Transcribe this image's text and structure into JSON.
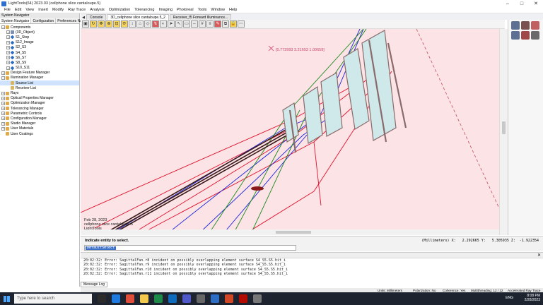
{
  "window": {
    "title": "LightTools(64) 2023.03  (cellphone slice cantaloupe.5)",
    "controls": [
      "–",
      "□",
      "✕"
    ]
  },
  "menu": [
    "File",
    "Edit",
    "View",
    "Insert",
    "Modify",
    "Ray Trace",
    "Analysis",
    "Optimization",
    "Tolerancing",
    "Imaging",
    "Photoreal",
    "Tools",
    "Window",
    "Help"
  ],
  "navigator": {
    "panel_title": "System Navigator",
    "tabs": [
      "System Navigator",
      "Configuration",
      "Preferences Na..."
    ],
    "tree": [
      {
        "label": "Components",
        "level": 0,
        "icon": "folder-icon",
        "expander": "−"
      },
      {
        "label": "(3D_Object)",
        "level": 1,
        "icon": "object-icon",
        "expander": "+"
      },
      {
        "label": "S1_Stop",
        "level": 1,
        "icon": "surface-icon",
        "expander": "+"
      },
      {
        "label": "S12_Image",
        "level": 1,
        "icon": "surface-icon",
        "expander": "+"
      },
      {
        "label": "S2_S3",
        "level": 1,
        "icon": "surface-icon",
        "expander": "+"
      },
      {
        "label": "S4_S5",
        "level": 1,
        "icon": "surface-icon",
        "expander": "+"
      },
      {
        "label": "S6_S7",
        "level": 1,
        "icon": "surface-icon",
        "expander": "+"
      },
      {
        "label": "S8_S9",
        "level": 1,
        "icon": "surface-icon",
        "expander": "+"
      },
      {
        "label": "S10_S11",
        "level": 1,
        "icon": "surface-icon",
        "expander": "+"
      },
      {
        "label": "Design Feature Manager",
        "level": 0,
        "icon": "folder-icon",
        "expander": "+"
      },
      {
        "label": "Illumination Manager",
        "level": 0,
        "icon": "folder-icon",
        "expander": "−"
      },
      {
        "label": "Source List",
        "level": 1,
        "icon": "list-icon",
        "expander": "",
        "selected": true
      },
      {
        "label": "Receiver List",
        "level": 1,
        "icon": "list-icon",
        "expander": ""
      },
      {
        "label": "Rays",
        "level": 0,
        "icon": "folder-icon",
        "expander": "+"
      },
      {
        "label": "Optical Properties Manager",
        "level": 0,
        "icon": "folder-icon",
        "expander": "+"
      },
      {
        "label": "Optimization Manager",
        "level": 0,
        "icon": "folder-icon",
        "expander": "+"
      },
      {
        "label": "Tolerancing Manager",
        "level": 0,
        "icon": "folder-icon",
        "expander": "+"
      },
      {
        "label": "Parametric Controls",
        "level": 0,
        "icon": "folder-icon",
        "expander": "+"
      },
      {
        "label": "Configuration Manager",
        "level": 0,
        "icon": "folder-icon",
        "expander": "+"
      },
      {
        "label": "Studio Manager",
        "level": 0,
        "icon": "folder-icon",
        "expander": "+"
      },
      {
        "label": "User Materials",
        "level": 0,
        "icon": "folder-icon",
        "expander": "+"
      },
      {
        "label": "User Coatings",
        "level": 0,
        "icon": "folder-icon",
        "expander": ""
      }
    ]
  },
  "doc_tabs": [
    {
      "label": "Console",
      "active": false
    },
    {
      "label": "3D_cellphone slice cantaloupe.5_2",
      "active": true
    },
    {
      "label": "Receiver_f5 Forward Illuminance...",
      "active": false
    }
  ],
  "viewport": {
    "cursor_coordinates": "[0.772993 3.21693 1.00659]",
    "stamp_lines": [
      "Feb 28, 2023",
      "cellphone slice cantaloupe.5",
      "LightTools"
    ],
    "colors": {
      "background": "#fbe3e6",
      "ray_red": "#e0102a",
      "ray_blue": "#1a25d8",
      "ray_green": "#1e8a1e",
      "lens_fill": "#cfe9ea",
      "lens_edge": "#8a6a6a"
    }
  },
  "prompt": {
    "message": "Indicate entity to select.",
    "units": "(Millimeters) X:   2.292665 Y:   5.305935 Z:  -1.922354",
    "command_value": "DefaultSelect"
  },
  "log": {
    "lines": [
      "20:02:32: Error: SagittalFan.r8 incident on possibly overlapping element surface S4_S5.S5.hit_i",
      "20:02:32: Error: SagittalFan.r9 incident on possibly overlapping element surface S4_S5.S5.hit_i",
      "20:02:32: Error: SagittalFan.r10 incident on possibly overlapping element surface S4_S5.S5.hit_i",
      "20:02:32: Error: SagittalFan.r11 incident on possibly overlapping element surface S4_S5.S5.hit_i"
    ],
    "tab_label": "Message Log"
  },
  "status": {
    "units": "Units: Millimeters",
    "polarization": "Polarization: No",
    "coherence": "Coherence: Yes",
    "multithreading": "Multithreading: 12 / 12",
    "raytrace": "Accelerated Ray Trace"
  },
  "taskbar": {
    "search_placeholder": "Type here to search",
    "lang": "ENG",
    "time": "8:08 PM",
    "date": "2/28/2023",
    "app_icons": [
      "task-view-icon",
      "edge-icon",
      "chrome-icon",
      "file-explorer-icon",
      "excel-icon",
      "mail-icon",
      "teams-icon",
      "settings-icon",
      "lighttools-icon",
      "powerpoint-icon",
      "acrobat-icon",
      "snip-icon"
    ]
  }
}
